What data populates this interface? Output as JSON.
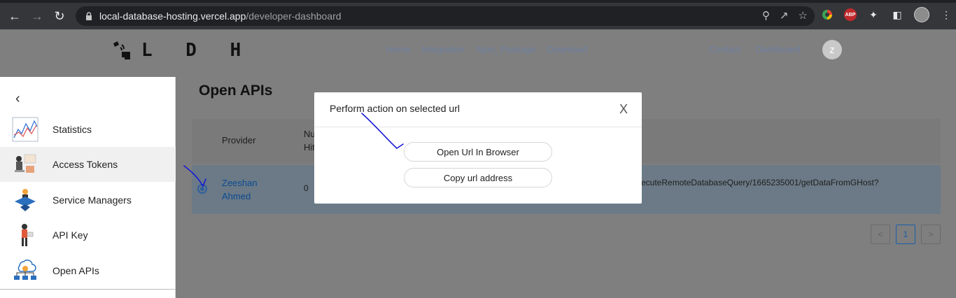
{
  "browser": {
    "url_host": "local-database-hosting.vercel.app",
    "url_path": "/developer-dashboard",
    "abp_label": "ABP"
  },
  "app": {
    "logo_text": "L D H",
    "nav": [
      "Home",
      "Integration",
      "Npm_Package",
      "Download"
    ],
    "nav_right": [
      "Contact",
      "Dashboard"
    ],
    "avatar_initial": "z"
  },
  "sidebar": {
    "items": [
      {
        "label": "Statistics",
        "icon": "statistics-icon"
      },
      {
        "label": "Access Tokens",
        "icon": "access-tokens-icon",
        "active": true
      },
      {
        "label": "Service Managers",
        "icon": "service-managers-icon"
      },
      {
        "label": "API Key",
        "icon": "api-key-icon"
      },
      {
        "label": "Open APIs",
        "icon": "open-apis-icon"
      }
    ]
  },
  "main": {
    "title": "Open APIs",
    "columns": {
      "provider": "Provider",
      "hits_line1": "Nu",
      "hits_line2": "Hit"
    },
    "row": {
      "provider_line1": "Zeeshan",
      "provider_line2": "Ahmed",
      "hits": "0",
      "url": "ecuteRemoteDatabaseQuery/1665235001/getDataFromGHost?"
    },
    "pagination": {
      "prev": "<",
      "current": "1",
      "next": ">"
    }
  },
  "modal": {
    "title": "Perform action on selected url",
    "close": "X",
    "open_button": "Open Url In Browser",
    "copy_button": "Copy url address"
  },
  "colors": {
    "annotation_stroke": "#1a1ad6",
    "link": "#0b4a93"
  }
}
